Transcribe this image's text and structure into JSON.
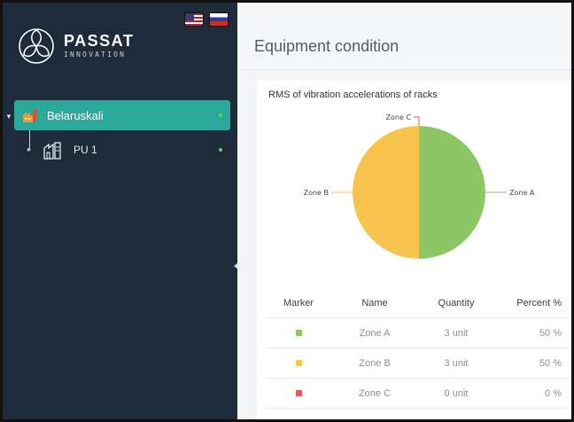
{
  "brand": {
    "title": "PASSAT",
    "subtitle": "INNOVATION"
  },
  "languages": [
    {
      "code": "en",
      "icon": "us-flag-icon"
    },
    {
      "code": "ru",
      "icon": "ru-flag-icon"
    }
  ],
  "tree": {
    "root": {
      "label": "Belaruskali",
      "icon": "factory-icon",
      "status_color": "#5fd35f"
    },
    "child": {
      "label": "PU 1",
      "icon": "plant-icon",
      "status_color": "#5fd35f"
    }
  },
  "page": {
    "title": "Equipment condition"
  },
  "chart_data": {
    "type": "pie",
    "title": "RMS of vibration accelerations of racks",
    "slices": [
      {
        "label": "Zone A",
        "value": 50,
        "color": "#8dc665"
      },
      {
        "label": "Zone B",
        "value": 50,
        "color": "#f7c54e"
      },
      {
        "label": "Zone C",
        "value": 0,
        "color": "#e8575f"
      }
    ]
  },
  "table": {
    "headers": [
      "Marker",
      "Name",
      "Quantity",
      "Percent %"
    ],
    "rows": [
      {
        "marker_color": "#8dc665",
        "name": "Zone A",
        "quantity": "3 unit",
        "percent": "50 %"
      },
      {
        "marker_color": "#f7c54e",
        "name": "Zone B",
        "quantity": "3 unit",
        "percent": "50 %"
      },
      {
        "marker_color": "#e8575f",
        "name": "Zone C",
        "quantity": "0 unit",
        "percent": "0 %"
      }
    ]
  }
}
